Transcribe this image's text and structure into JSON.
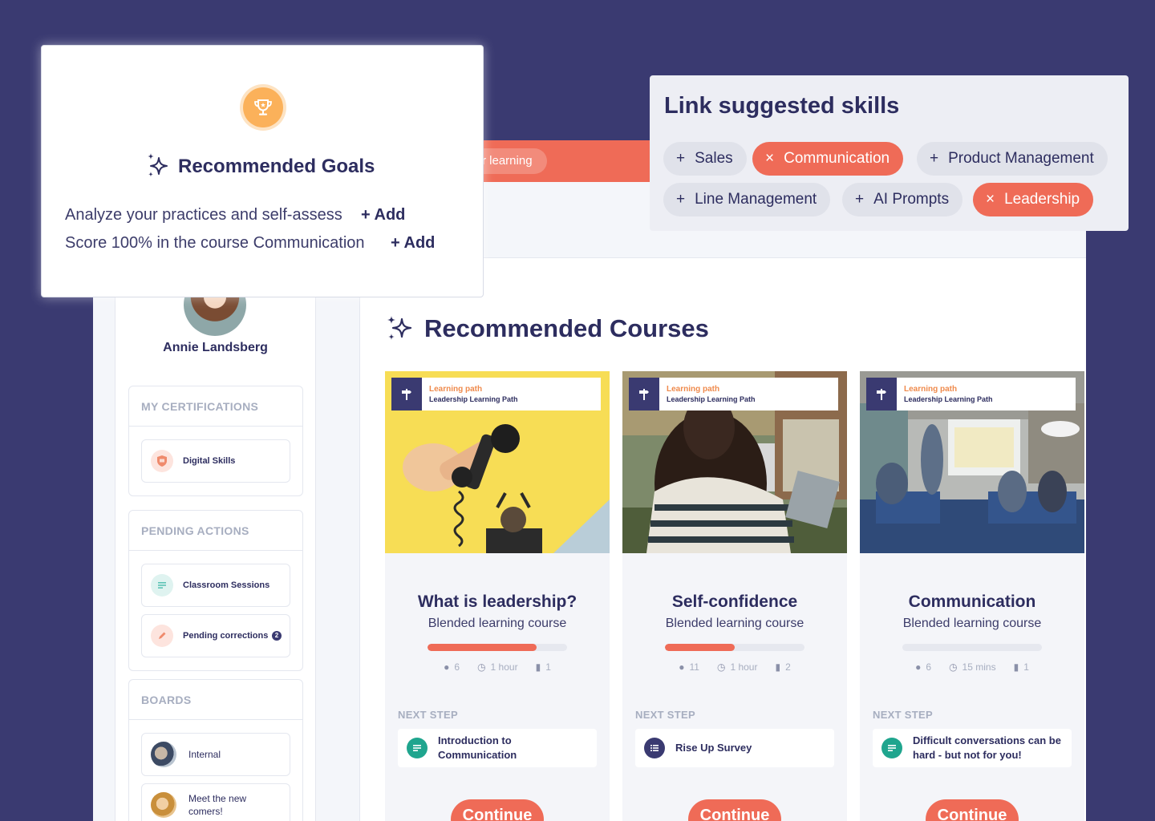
{
  "topbar": {
    "pill_label": "r learning"
  },
  "sidebar": {
    "user_name": "Annie Landsberg",
    "certifications": {
      "title": "MY CERTIFICATIONS",
      "items": [
        {
          "label": "Digital Skills"
        }
      ]
    },
    "pending_actions": {
      "title": "PENDING ACTIONS",
      "items": [
        {
          "label": "Classroom Sessions"
        },
        {
          "label": "Pending corrections",
          "badge": "2"
        }
      ]
    },
    "boards": {
      "title": "BOARDS",
      "items": [
        {
          "label": "Internal"
        },
        {
          "label": "Meet the new comers!"
        }
      ]
    }
  },
  "main": {
    "title": "Recommended Courses",
    "courses": [
      {
        "tag_kind": "Learning path",
        "tag_name": "Leadership Learning Path",
        "title": "What is leadership?",
        "subtitle": "Blended learning course",
        "progress": 0.78,
        "learners": "6",
        "duration": "1 hour",
        "comments": "1",
        "next_label": "NEXT STEP",
        "next_step": "Introduction to Communication",
        "next_icon": "document-icon",
        "next_color": "#1fa58e",
        "button": "Continue"
      },
      {
        "tag_kind": "Learning path",
        "tag_name": "Leadership Learning Path",
        "title": "Self-confidence",
        "subtitle": "Blended learning course",
        "progress": 0.5,
        "learners": "11",
        "duration": "1 hour",
        "comments": "2",
        "next_label": "NEXT STEP",
        "next_step": "Rise Up Survey",
        "next_icon": "checklist-icon",
        "next_color": "#3a3a71",
        "button": "Continue"
      },
      {
        "tag_kind": "Learning path",
        "tag_name": "Leadership Learning Path",
        "title": "Communication",
        "subtitle": "Blended learning course",
        "progress": 0,
        "learners": "6",
        "duration": "15 mins",
        "comments": "1",
        "next_label": "NEXT STEP",
        "next_step": "Difficult conversations can be hard - but not for you!",
        "next_icon": "document-icon",
        "next_color": "#1fa58e",
        "button": "Continue"
      }
    ]
  },
  "goals_popup": {
    "title": "Recommended Goals",
    "goals": [
      {
        "text": "Analyze your practices and self-assess",
        "action": "+ Add"
      },
      {
        "text": "Score 100% in the course Communication",
        "action": "+ Add"
      }
    ]
  },
  "skills_popup": {
    "title": "Link suggested skills",
    "skills": [
      {
        "label": "Sales",
        "selected": false
      },
      {
        "label": "Communication",
        "selected": true
      },
      {
        "label": "Product Management",
        "selected": false
      },
      {
        "label": "Line Management",
        "selected": false
      },
      {
        "label": "AI Prompts",
        "selected": false
      },
      {
        "label": "Leadership",
        "selected": true
      }
    ]
  },
  "colors": {
    "background": "#3a3a71",
    "accent": "#ef6b57",
    "navy": "#2d2d5f",
    "trophy": "#fbb15a"
  }
}
